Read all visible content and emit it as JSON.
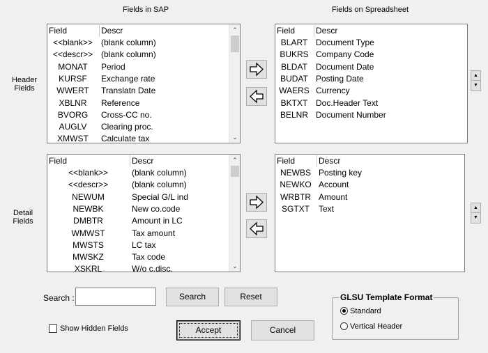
{
  "titles": {
    "sap": "Fields in SAP",
    "spreadsheet": "Fields on Spreadsheet"
  },
  "side_labels": {
    "header": "Header\nFields",
    "detail": "Detail\nFields"
  },
  "header_sap": {
    "col_field": "Field",
    "col_descr": "Descr",
    "rows": [
      {
        "field": "<<blank>>",
        "descr": "(blank column)"
      },
      {
        "field": "<<descr>>",
        "descr": "(blank column)"
      },
      {
        "field": "MONAT",
        "descr": "Period"
      },
      {
        "field": "KURSF",
        "descr": "Exchange rate"
      },
      {
        "field": "WWERT",
        "descr": "Translatn Date"
      },
      {
        "field": "XBLNR",
        "descr": "Reference"
      },
      {
        "field": "BVORG",
        "descr": "Cross-CC no."
      },
      {
        "field": "AUGLV",
        "descr": "Clearing proc."
      },
      {
        "field": "XMWST",
        "descr": "Calculate tax"
      }
    ]
  },
  "header_sheet": {
    "col_field": "Field",
    "col_descr": "Descr",
    "rows": [
      {
        "field": "BLART",
        "descr": "Document Type"
      },
      {
        "field": "BUKRS",
        "descr": "Company Code"
      },
      {
        "field": "BLDAT",
        "descr": "Document Date"
      },
      {
        "field": "BUDAT",
        "descr": "Posting Date"
      },
      {
        "field": "WAERS",
        "descr": "Currency"
      },
      {
        "field": "BKTXT",
        "descr": "Doc.Header Text"
      },
      {
        "field": "BELNR",
        "descr": "Document Number"
      }
    ]
  },
  "detail_sap": {
    "col_field": "Field",
    "col_descr": "Descr",
    "rows": [
      {
        "field": "<<blank>>",
        "descr": "(blank column)"
      },
      {
        "field": "<<descr>>",
        "descr": "(blank column)"
      },
      {
        "field": "NEWUM",
        "descr": "Special G/L ind"
      },
      {
        "field": "NEWBK",
        "descr": "New co.code"
      },
      {
        "field": "DMBTR",
        "descr": "Amount in LC"
      },
      {
        "field": "WMWST",
        "descr": "Tax amount"
      },
      {
        "field": "MWSTS",
        "descr": "LC tax"
      },
      {
        "field": "MWSKZ",
        "descr": "Tax code"
      },
      {
        "field": "XSKRL",
        "descr": "W/o c.disc."
      }
    ]
  },
  "detail_sheet": {
    "col_field": "Field",
    "col_descr": "Descr",
    "rows": [
      {
        "field": "NEWBS",
        "descr": "Posting key"
      },
      {
        "field": "NEWKO",
        "descr": "Account"
      },
      {
        "field": "WRBTR",
        "descr": "Amount"
      },
      {
        "field": "SGTXT",
        "descr": "Text"
      }
    ]
  },
  "search": {
    "label": "Search :",
    "value": "",
    "search_button": "Search",
    "reset_button": "Reset"
  },
  "show_hidden": {
    "label": "Show Hidden Fields",
    "checked": false
  },
  "buttons": {
    "accept": "Accept",
    "cancel": "Cancel"
  },
  "template_format": {
    "title": "GLSU Template Format",
    "options": [
      "Standard",
      "Vertical Header"
    ],
    "selected": "Standard"
  },
  "icons": {
    "move_right": "right-arrow-icon",
    "move_left": "left-arrow-icon",
    "scroll_up": "chevron-up-icon",
    "scroll_down": "chevron-down-icon"
  }
}
